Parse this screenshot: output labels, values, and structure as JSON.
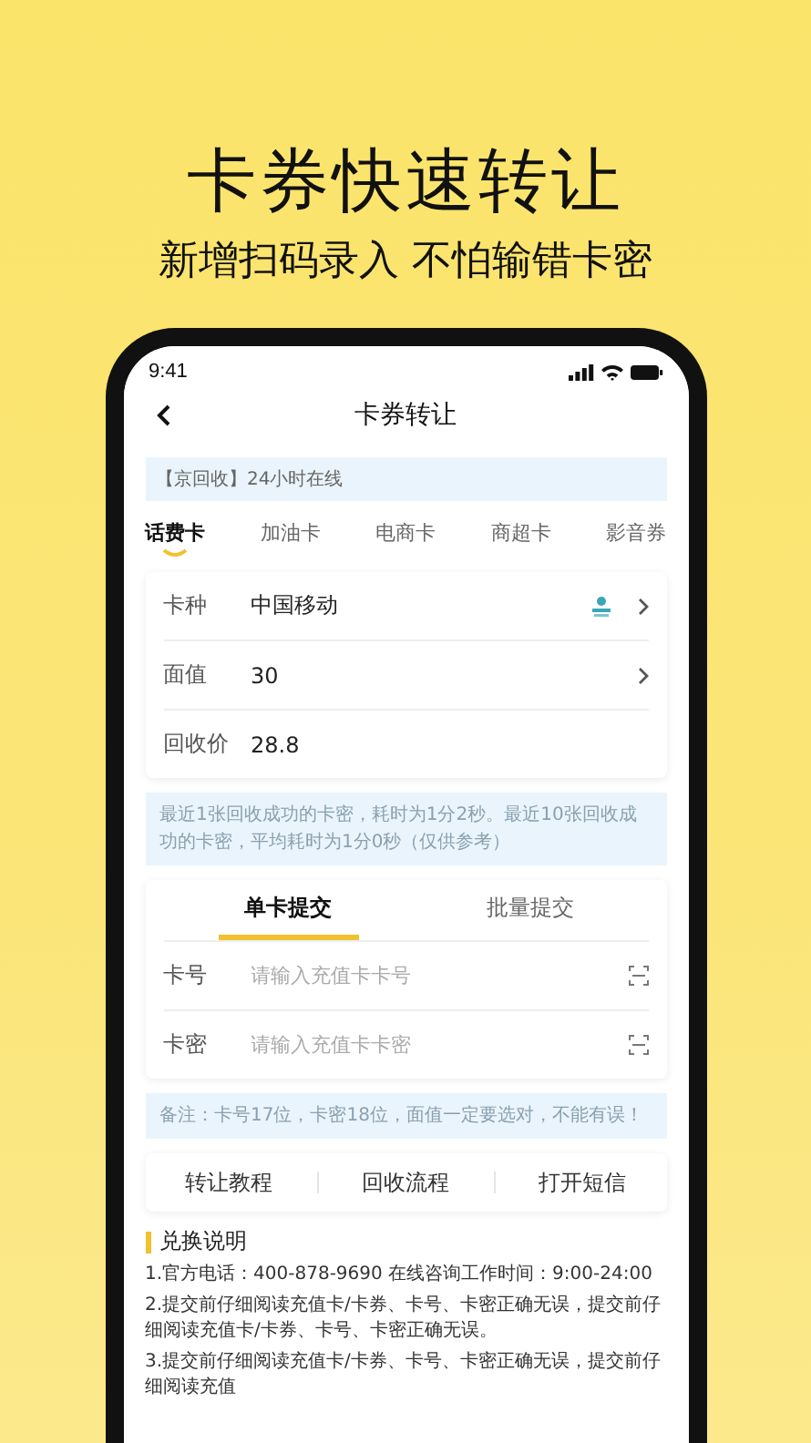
{
  "headline": "卡券快速转让",
  "subtitle": "新增扫码录入 不怕输错卡密",
  "status_bar": {
    "time": "9:41"
  },
  "nav": {
    "title": "卡券转让"
  },
  "banner": "【京回收】24小时在线",
  "tabs": [
    {
      "label": "话费卡",
      "selected": true
    },
    {
      "label": "加油卡",
      "selected": false
    },
    {
      "label": "电商卡",
      "selected": false
    },
    {
      "label": "商超卡",
      "selected": false
    },
    {
      "label": "影音券",
      "selected": false
    }
  ],
  "card_fields": [
    {
      "label": "卡种",
      "value": "中国移动",
      "kind": "carrier"
    },
    {
      "label": "面值",
      "value": "30",
      "kind": "select"
    },
    {
      "label": "回收价",
      "value": "28.8",
      "kind": "plain"
    }
  ],
  "timing_note": "最近1张回收成功的卡密，耗时为1分2秒。最近10张回收成功的卡密，平均耗时为1分0秒（仅供参考）",
  "submit_tabs": [
    {
      "label": "单卡提交",
      "selected": true
    },
    {
      "label": "批量提交",
      "selected": false
    }
  ],
  "inputs": [
    {
      "label": "卡号",
      "placeholder": "请输入充值卡卡号"
    },
    {
      "label": "卡密",
      "placeholder": "请输入充值卡卡密"
    }
  ],
  "remark": "备注：卡号17位，卡密18位，面值一定要选对，不能有误！",
  "links": [
    "转让教程",
    "回收流程",
    "打开短信"
  ],
  "instructions": {
    "title": "兑换说明",
    "items": [
      "1.官方电话：400-878-9690 在线咨询工作时间：9:00-24:00",
      "2.提交前仔细阅读充值卡/卡券、卡号、卡密正确无误，提交前仔细阅读充值卡/卡券、卡号、卡密正确无误。",
      "3.提交前仔细阅读充值卡/卡券、卡号、卡密正确无误，提交前仔细阅读充值"
    ]
  }
}
